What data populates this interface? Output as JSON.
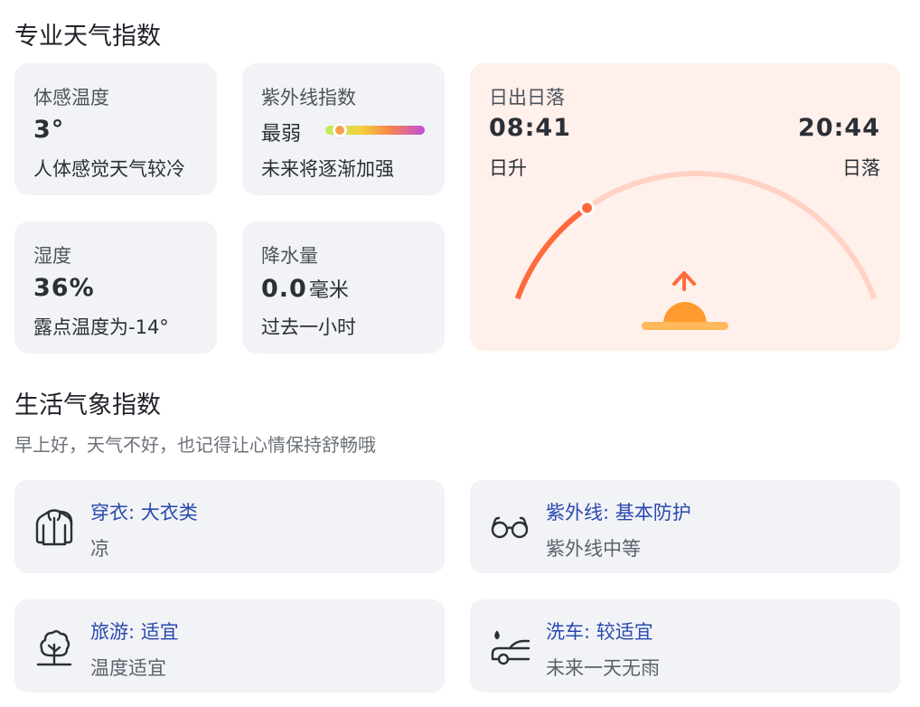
{
  "professional": {
    "title": "专业天气指数",
    "feels_like": {
      "label": "体感温度",
      "value": "3°",
      "desc": "人体感觉天气较冷"
    },
    "uv": {
      "label": "紫外线指数",
      "level": "最弱",
      "level_fraction": 0.08,
      "desc": "未来将逐渐加强"
    },
    "humidity": {
      "label": "湿度",
      "value": "36%",
      "desc": "露点温度为-14°"
    },
    "precipitation": {
      "label": "降水量",
      "value": "0.0",
      "unit": "毫米",
      "desc": "过去一小时"
    },
    "sun": {
      "label": "日出日落",
      "sunrise_time": "08:41",
      "sunset_time": "20:44",
      "sunrise_label": "日升",
      "sunset_label": "日落",
      "day_progress": 0.25,
      "colors": {
        "arc_done": "#ff6a3d",
        "arc_rest": "#ffd2c4",
        "sun": "#ff9a2e",
        "horizon": "#ffb85c",
        "arrow": "#ff6a3d"
      }
    }
  },
  "life": {
    "title": "生活气象指数",
    "subtitle": "早上好，天气不好，也记得让心情保持舒畅哦",
    "items": [
      {
        "title": "穿衣: 大衣类",
        "detail": "凉",
        "icon": "coat-icon"
      },
      {
        "title": "紫外线: 基本防护",
        "detail": "紫外线中等",
        "icon": "glasses-icon"
      },
      {
        "title": "旅游: 适宜",
        "detail": "温度适宜",
        "icon": "tree-icon"
      },
      {
        "title": "洗车: 较适宜",
        "detail": "未来一天无雨",
        "icon": "car-wash-icon"
      }
    ],
    "colors": {
      "title": "#2848b0",
      "detail": "#5b616b"
    }
  }
}
